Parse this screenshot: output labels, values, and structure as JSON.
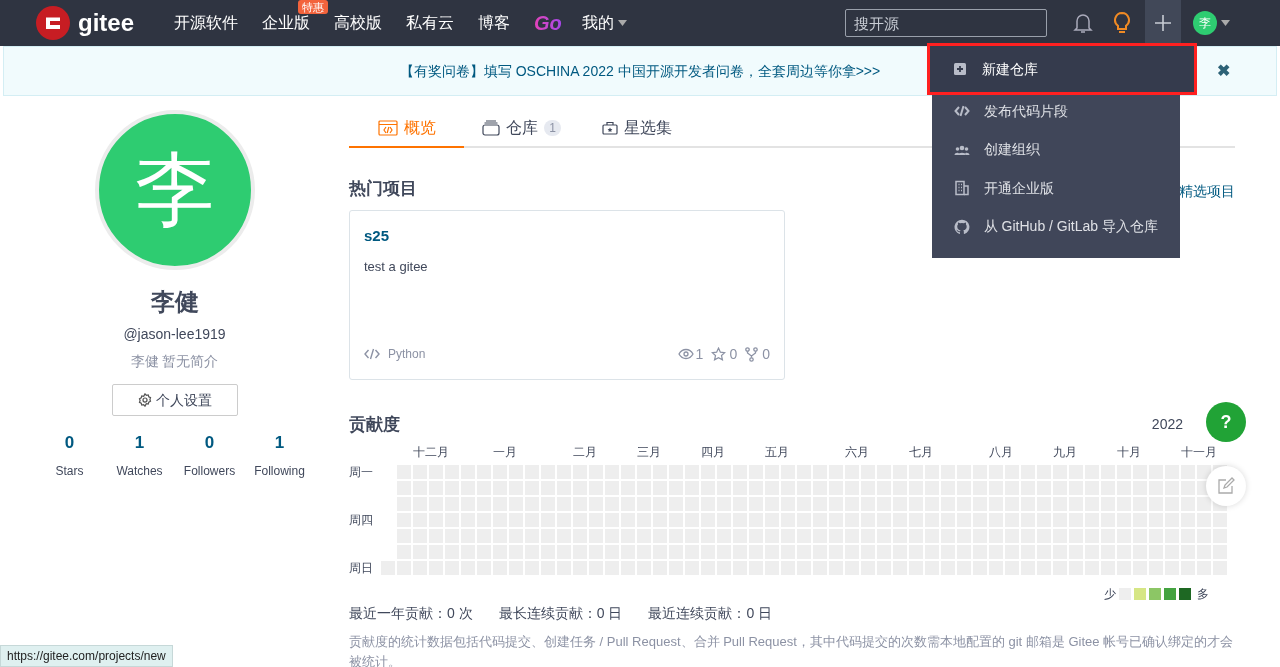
{
  "nav": {
    "logo": "gitee",
    "items": [
      {
        "label": "开源软件"
      },
      {
        "label": "企业版",
        "badge": "特惠"
      },
      {
        "label": "高校版"
      },
      {
        "label": "私有云"
      },
      {
        "label": "博客"
      }
    ],
    "go": "Go",
    "mine": "我的",
    "search": {
      "placeholder": "搜开源"
    },
    "avatar": "李"
  },
  "banner": {
    "text": "【有奖问卷】填写 OSCHINA 2022 中国开源开发者问卷，全套周边等你拿>>>",
    "close": "✖"
  },
  "profile": {
    "avatar": "李",
    "name": "李健",
    "handle": "@jason-lee1919",
    "bio": "李健 暂无简介",
    "settings_button": "个人设置",
    "stats": [
      {
        "value": "0",
        "label": "Stars"
      },
      {
        "value": "1",
        "label": "Watches"
      },
      {
        "value": "0",
        "label": "Followers"
      },
      {
        "value": "1",
        "label": "Following"
      }
    ]
  },
  "tabs": [
    {
      "label": "概览",
      "selected": true
    },
    {
      "label": "仓库",
      "count": "1",
      "selected": false
    },
    {
      "label": "星选集",
      "selected": false
    }
  ],
  "hot": {
    "title": "热门项目",
    "side_link": "精选项目",
    "projects": [
      {
        "name": "s25",
        "description": "test a gitee",
        "language": "Python",
        "watches": "1",
        "stars": "0",
        "forks": "0"
      }
    ]
  },
  "contrib": {
    "title": "贡献度",
    "year": "2022",
    "months": [
      "十二月",
      "一月",
      "二月",
      "三月",
      "四月",
      "五月",
      "六月",
      "七月",
      "八月",
      "九月",
      "十月",
      "十一月"
    ],
    "weekdays": [
      "周一",
      "周四",
      "周日"
    ],
    "legend": {
      "low": "少",
      "high": "多",
      "swatches": [
        {
          "color": "#eeeeee"
        },
        {
          "color": "#d6e685"
        },
        {
          "color": "#8cc665"
        },
        {
          "color": "#44a340"
        },
        {
          "color": "#1e6823"
        }
      ]
    },
    "summary": [
      "最近一年贡献：0 次",
      "最长连续贡献：0 日",
      "最近连续贡献：0 日"
    ],
    "note": "贡献度的统计数据包括代码提交、创建任务 / Pull Request、合并 Pull Request，其中代码提交的次数需本地配置的 git 邮箱是 Gitee 帐号已确认绑定的才会被统计。"
  },
  "help_button": "?",
  "menu": [
    {
      "kind": "plus",
      "label": "新建仓库",
      "selected": true
    },
    {
      "kind": "code",
      "label": "发布代码片段",
      "selected": false
    },
    {
      "kind": "people",
      "label": "创建组织",
      "selected": false
    },
    {
      "kind": "building",
      "label": "开通企业版",
      "selected": false
    },
    {
      "kind": "github",
      "label": "从 GitHub / GitLab 导入仓库",
      "selected": false
    }
  ],
  "status_url": "https://gitee.com/projects/new"
}
